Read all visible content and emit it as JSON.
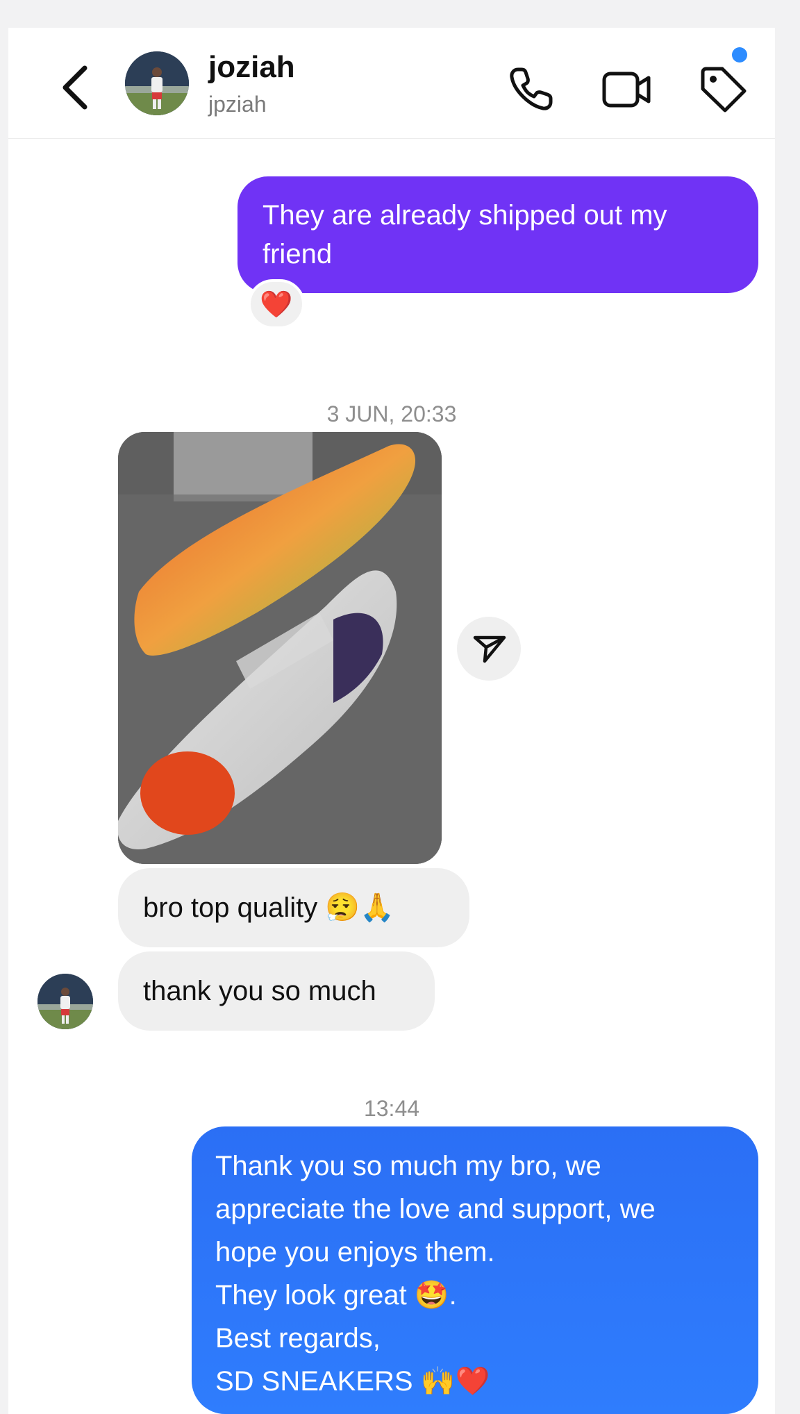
{
  "header": {
    "name": "joziah",
    "username": "jpziah",
    "accent_dot_color": "#2d8cff",
    "icons": [
      "back-icon",
      "phone-icon",
      "video-icon",
      "tag-icon"
    ]
  },
  "messages": {
    "outgoing_1": "They are already shipped out my friend",
    "reaction_1": "❤️",
    "timestamp_1": "3 JUN, 20:33",
    "incoming_1": "bro top quality 😮‍💨🙏",
    "incoming_2": "thank you so much",
    "timestamp_2": "13:44",
    "outgoing_2_lines": [
      "Thank you so much my bro, we",
      "appreciate the love and support, we",
      "hope you enjoys them.",
      "They look great 🤩.",
      "Best regards,",
      "SD SNEAKERS 🙌❤️"
    ]
  },
  "colors": {
    "outgoing_purple": "#7033f5",
    "outgoing_blue": "#2f7dfd",
    "incoming_bg": "#efefef"
  }
}
